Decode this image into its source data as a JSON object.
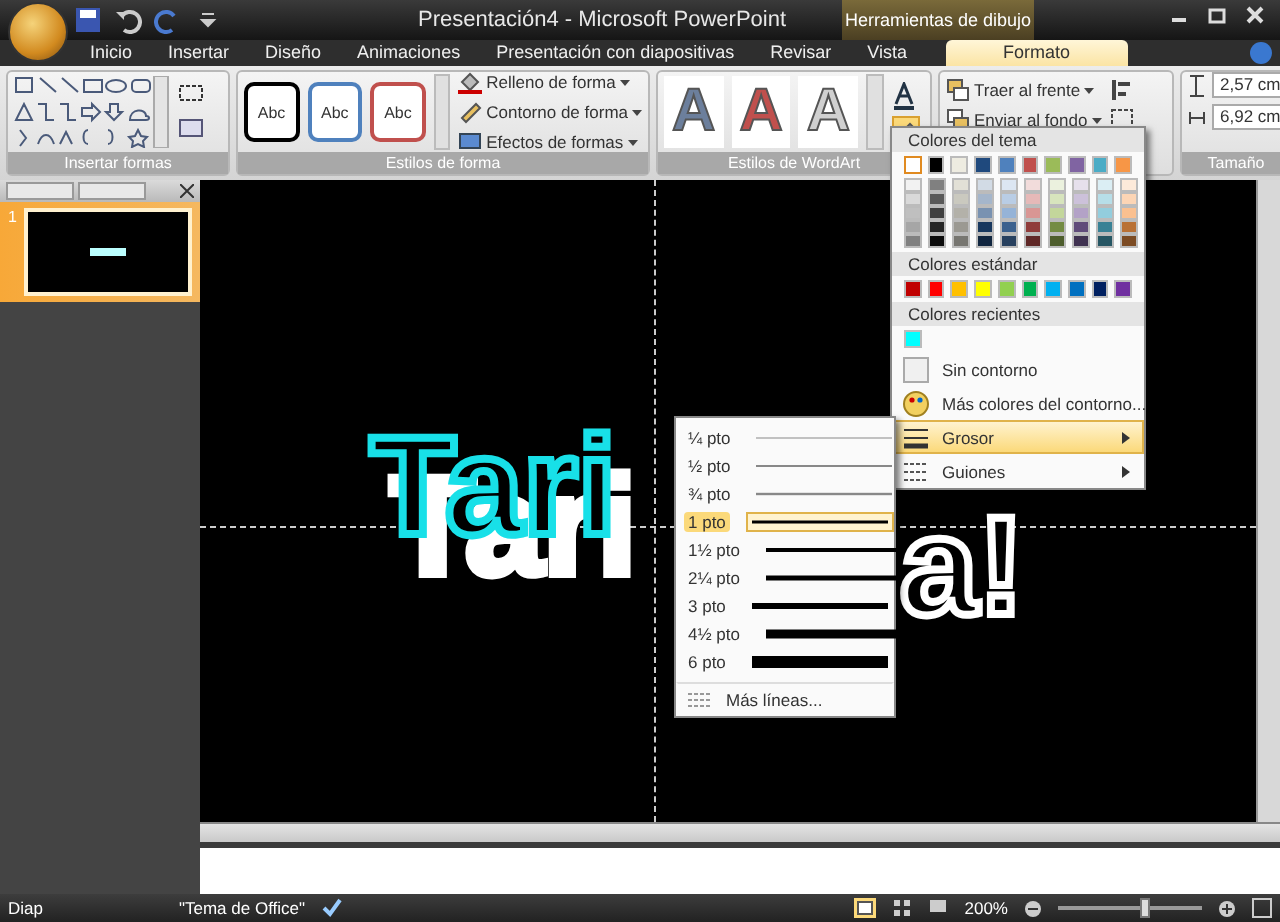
{
  "window": {
    "title": "Presentación4 - Microsoft PowerPoint",
    "context_header": "Herramientas de dibujo"
  },
  "tabs": [
    {
      "label": "Inicio",
      "selected": false
    },
    {
      "label": "Insertar",
      "selected": false
    },
    {
      "label": "Diseño",
      "selected": false
    },
    {
      "label": "Animaciones",
      "selected": false
    },
    {
      "label": "Presentación con diapositivas",
      "selected": false
    },
    {
      "label": "Revisar",
      "selected": false
    },
    {
      "label": "Vista",
      "selected": false
    },
    {
      "label": "Formato",
      "selected": true
    }
  ],
  "insert_shapes": {
    "label": "Insertar formas"
  },
  "shape_styles": {
    "label": "Estilos de forma",
    "styles": [
      {
        "text": "Abc",
        "color": "#000000"
      },
      {
        "text": "Abc",
        "color": "#4f81bd"
      },
      {
        "text": "Abc",
        "color": "#c0504d"
      }
    ],
    "commands": [
      "Relleno de forma",
      "Contorno de forma",
      "Efectos de formas"
    ]
  },
  "wordart_styles": {
    "label": "Estilos de WordArt",
    "styles": [
      {
        "text": "A",
        "color": "#6c7f9c"
      },
      {
        "text": "A",
        "color": "#c0504d"
      },
      {
        "text": "A",
        "color": "#d0d0d0"
      }
    ]
  },
  "arrange": {
    "commands": [
      "Traer al frente",
      "Enviar al fondo"
    ]
  },
  "size": {
    "label": "Tamaño",
    "height": "2,57 cm",
    "width": "6,92 cm"
  },
  "slides_pane": {
    "slide_number": "1"
  },
  "slide": {
    "title_start": "Tari",
    "title_end": "a!"
  },
  "outline_menu": {
    "theme_header": "Colores del tema",
    "theme_colors": [
      {
        "color": "#ffffff",
        "selected": true
      },
      {
        "color": "#000000",
        "selected": false
      },
      {
        "color": "#eeece1",
        "selected": false
      },
      {
        "color": "#1f497d",
        "selected": false
      },
      {
        "color": "#4f81bd",
        "selected": false
      },
      {
        "color": "#c0504d",
        "selected": false
      },
      {
        "color": "#9bbb59",
        "selected": false
      },
      {
        "color": "#8064a2",
        "selected": false
      },
      {
        "color": "#4bacc6",
        "selected": false
      },
      {
        "color": "#f79646",
        "selected": false
      }
    ],
    "standard_header": "Colores estándar",
    "standard_colors": [
      {
        "color": "#c00000"
      },
      {
        "color": "#ff0000"
      },
      {
        "color": "#ffc000"
      },
      {
        "color": "#ffff00"
      },
      {
        "color": "#92d050"
      },
      {
        "color": "#00b050"
      },
      {
        "color": "#00b0f0"
      },
      {
        "color": "#0070c0"
      },
      {
        "color": "#002060"
      },
      {
        "color": "#7030a0"
      }
    ],
    "recent_header": "Colores recientes",
    "recent_colors": [
      {
        "color": "#00ffff"
      }
    ],
    "items": [
      {
        "label": "Sin contorno",
        "kind": "none",
        "selected": false
      },
      {
        "label": "Más colores del contorno...",
        "kind": "palette",
        "selected": false
      },
      {
        "label": "Grosor",
        "kind": "weight",
        "selected": true
      },
      {
        "label": "Guiones",
        "kind": "dash",
        "selected": false
      }
    ]
  },
  "weight_menu": {
    "items": [
      {
        "label": "¼ pto",
        "selected": false
      },
      {
        "label": "½ pto",
        "selected": false
      },
      {
        "label": "¾ pto",
        "selected": false
      },
      {
        "label": "1 pto",
        "selected": true
      },
      {
        "label": "1½ pto",
        "selected": false
      },
      {
        "label": "2¼ pto",
        "selected": false
      },
      {
        "label": "3 pto",
        "selected": false
      },
      {
        "label": "4½ pto",
        "selected": false
      },
      {
        "label": "6 pto",
        "selected": false
      }
    ],
    "more": "Más líneas..."
  },
  "status_bar": {
    "slide": "Diap",
    "theme": "\"Tema de Office\"",
    "zoom": "200%",
    "zoom_slider": {
      "level": 0.61
    }
  }
}
